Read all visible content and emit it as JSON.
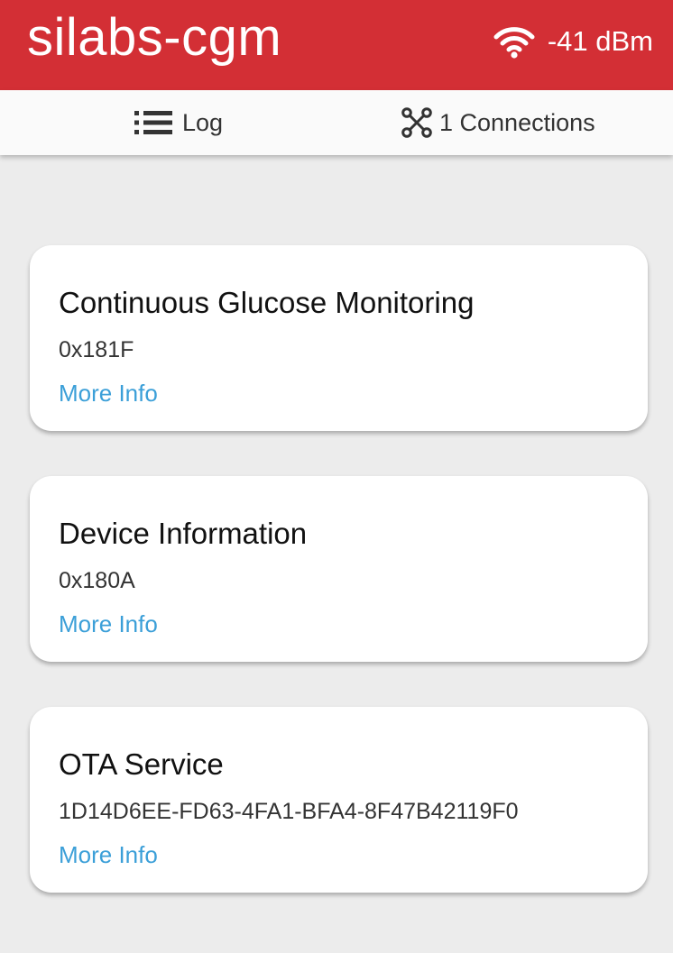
{
  "app_bar": {
    "title": "silabs-cgm",
    "signal_icon": "wifi-icon",
    "rssi": "-41 dBm",
    "background_color": "#d32f35"
  },
  "tabs": {
    "log_label": "Log",
    "log_icon": "list-icon",
    "connections_label": "1 Connections",
    "connections_icon": "connections-icon"
  },
  "services": [
    {
      "name": "Continuous Glucose Monitoring",
      "uuid": "0x181F",
      "link": "More Info"
    },
    {
      "name": "Device Information",
      "uuid": "0x180A",
      "link": "More Info"
    },
    {
      "name": "OTA Service",
      "uuid": "1D14D6EE-FD63-4FA1-BFA4-8F47B42119F0",
      "link": "More Info"
    }
  ],
  "colors": {
    "link": "#3b9fd8",
    "background": "#ececec"
  }
}
